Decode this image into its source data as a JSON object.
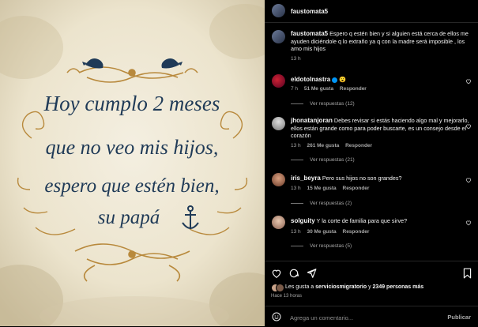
{
  "post": {
    "author": "faustomata5",
    "caption": "Espero q estén bien y si alguien está cerca de ellos me ayuden diciéndole q lo extraño ya q con la madre será imposible , los amo mis hijos",
    "caption_time": "13 h"
  },
  "image": {
    "line1": "Hoy cumplo 2 meses",
    "line2": "que no veo mis hijos,",
    "line3": "espero que estén bien,",
    "line4": "su papá"
  },
  "comments": [
    {
      "user": "eldotolnastra",
      "text": "😮",
      "time": "7 h",
      "likes": "51 Me gusta",
      "reply": "Responder",
      "view": "Ver respuestas (12)"
    },
    {
      "user": "jhonatanjoran",
      "text": "Debes revisar si estás haciendo algo mal y mejorarlo, ellos están grande como para poder buscarte, es un consejo desde el corazón",
      "time": "13 h",
      "likes": "261 Me gusta",
      "reply": "Responder",
      "view": "Ver respuestas (21)"
    },
    {
      "user": "iris_beyra",
      "text": "Pero sus hijos no son grandes?",
      "time": "13 h",
      "likes": "15 Me gusta",
      "reply": "Responder",
      "view": "Ver respuestas (2)"
    },
    {
      "user": "solguity",
      "text": "Y la corte de familia para que sirve?",
      "time": "13 h",
      "likes": "30 Me gusta",
      "reply": "Responder",
      "view": "Ver respuestas (5)"
    }
  ],
  "likes_summary": {
    "prefix": "Les gusta a",
    "user": "serviciosmigratorio",
    "middle": "y",
    "count": "2349 personas más",
    "time": "Hace 13 horas"
  },
  "add_comment": {
    "placeholder": "Agrega un comentario...",
    "publish": "Publicar"
  },
  "colors": {
    "verified": "#0095f6",
    "poster_text": "#1f3a57",
    "poster_ornament": "#b8893c"
  }
}
